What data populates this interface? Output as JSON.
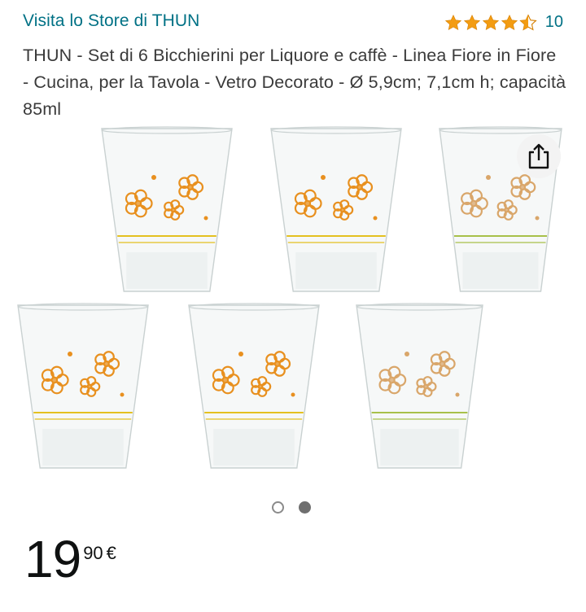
{
  "store": {
    "link_text": "Visita lo Store di THUN"
  },
  "rating": {
    "stars": 4.5,
    "count": "10",
    "color": "#f39c12"
  },
  "product": {
    "title": "THUN - Set di 6 Bicchierini per Liquore e caffè - Linea Fiore in Fiore - Cucina, per la Tavola - Vetro Decorato - Ø 5,9cm; 7,1cm h; capacità 85ml"
  },
  "gallery": {
    "image_count": 2,
    "active_index": 1,
    "glasses": [
      {
        "flower_color": "#e8901f",
        "band_color": "#e4c020"
      },
      {
        "flower_color": "#e8901f",
        "band_color": "#e4c020"
      },
      {
        "flower_color": "#d9a66a",
        "band_color": "#a8c04a"
      },
      {
        "flower_color": "#e8901f",
        "band_color": "#e4c020"
      },
      {
        "flower_color": "#e8901f",
        "band_color": "#e4c020"
      },
      {
        "flower_color": "#d9a66a",
        "band_color": "#a8c04a"
      }
    ]
  },
  "price": {
    "whole": "19",
    "fraction": "90",
    "currency": "€"
  },
  "colors": {
    "link": "#007185",
    "text": "#3a3a3a",
    "star": "#f39c12"
  }
}
